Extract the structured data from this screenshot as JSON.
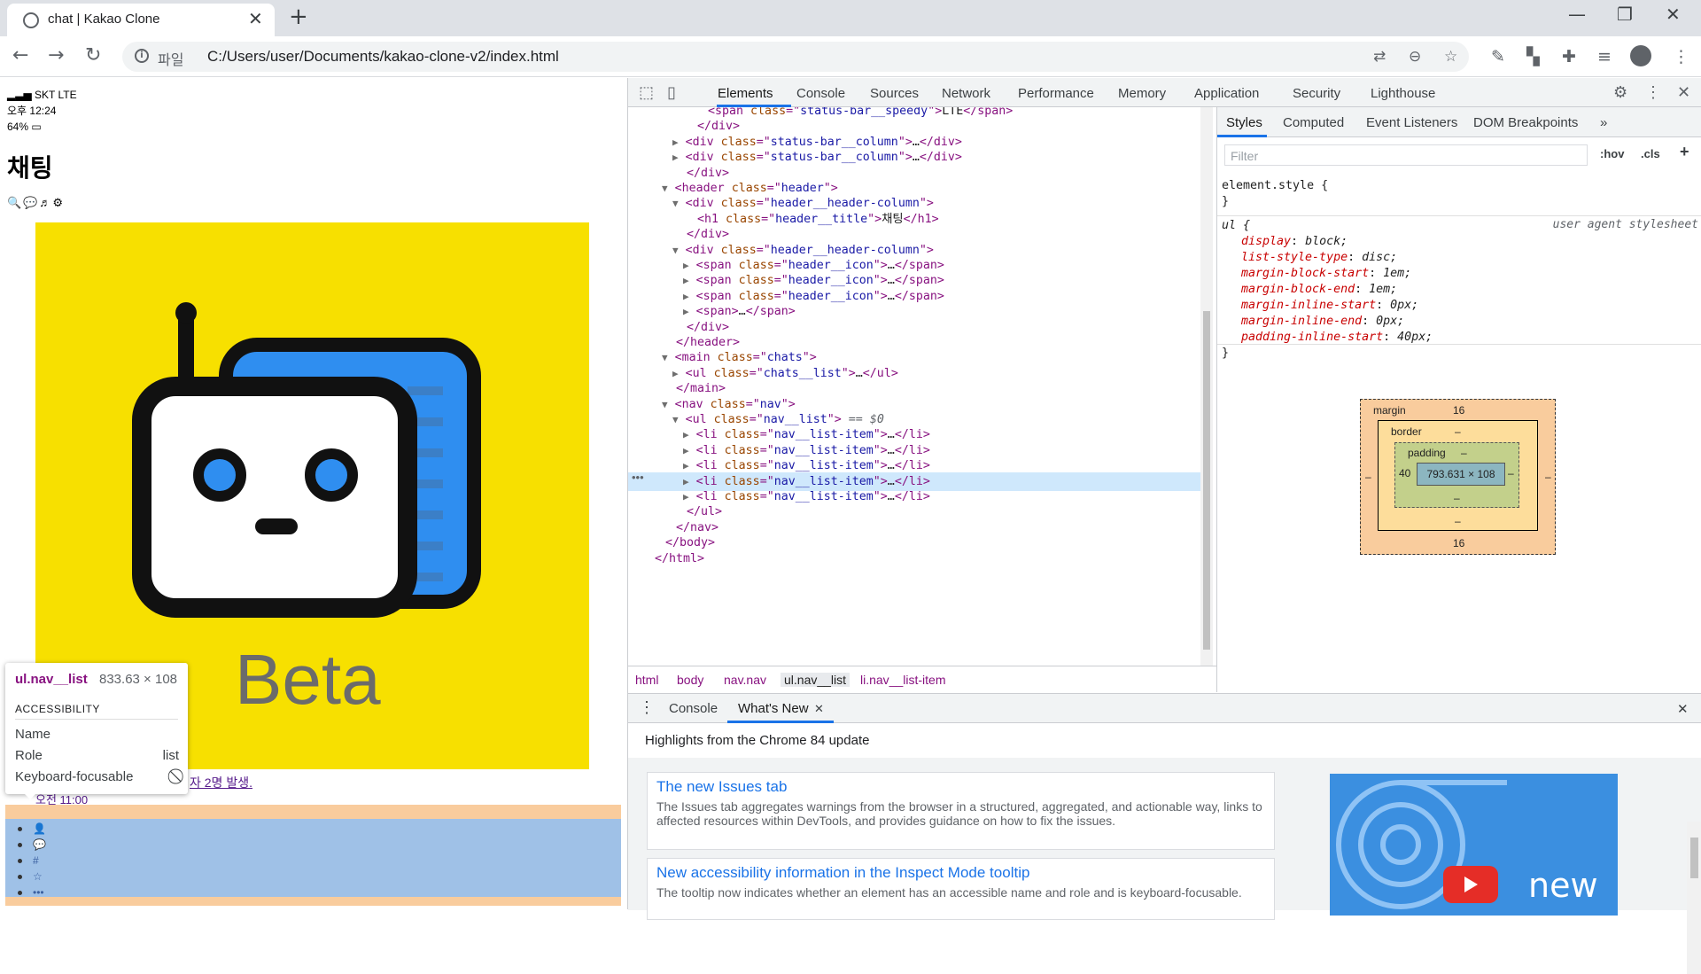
{
  "browser": {
    "tab_title": "chat | Kakao Clone",
    "address_label": "파일",
    "url": "C:/Users/user/Documents/kakao-clone-v2/index.html"
  },
  "page": {
    "status_carrier": "SKT LTE",
    "status_time": "오후 12:24",
    "status_battery": "64%",
    "heading": "채팅",
    "header_icons": "🔍💬♬⚙",
    "image_text": "Beta",
    "chat_link_1": "자 2명 발생.",
    "chat_link_2": "오전 11:00",
    "nav_items": [
      "👤",
      "💬",
      "#",
      "☆",
      "•••"
    ]
  },
  "tooltip": {
    "tag": "ul.nav__list",
    "size": "833.63 × 108",
    "section": "ACCESSIBILITY",
    "rows": [
      {
        "label": "Name",
        "value": ""
      },
      {
        "label": "Role",
        "value": "list"
      },
      {
        "label": "Keyboard-focusable",
        "value": "⃠"
      }
    ]
  },
  "devtools": {
    "tabs": [
      "Elements",
      "Console",
      "Sources",
      "Network",
      "Performance",
      "Memory",
      "Application",
      "Security",
      "Lighthouse"
    ],
    "dom_lines": [
      {
        "indent": 5,
        "tri": "",
        "html": "<span class=\"status-bar__speedy\">LTE</span>"
      },
      {
        "indent": 4,
        "tri": "",
        "html": "</div>"
      },
      {
        "indent": 3,
        "tri": "▶",
        "html": "<div class=\"status-bar__column\">…</div>"
      },
      {
        "indent": 3,
        "tri": "▶",
        "html": "<div class=\"status-bar__column\">…</div>"
      },
      {
        "indent": 3,
        "tri": "",
        "html": "</div>"
      },
      {
        "indent": 2,
        "tri": "▼",
        "html": "<header class=\"header\">"
      },
      {
        "indent": 3,
        "tri": "▼",
        "html": "<div class=\"header__header-column\">"
      },
      {
        "indent": 4,
        "tri": "",
        "html": "<h1 class=\"header__title\">채팅</h1>"
      },
      {
        "indent": 3,
        "tri": "",
        "html": "</div>"
      },
      {
        "indent": 3,
        "tri": "▼",
        "html": "<div class=\"header__header-column\">"
      },
      {
        "indent": 4,
        "tri": "▶",
        "html": "<span class=\"header__icon\">…</span>"
      },
      {
        "indent": 4,
        "tri": "▶",
        "html": "<span class=\"header__icon\">…</span>"
      },
      {
        "indent": 4,
        "tri": "▶",
        "html": "<span class=\"header__icon\">…</span>"
      },
      {
        "indent": 4,
        "tri": "▶",
        "html": "<span>…</span>"
      },
      {
        "indent": 3,
        "tri": "",
        "html": "</div>"
      },
      {
        "indent": 2,
        "tri": "",
        "html": "</header>"
      },
      {
        "indent": 2,
        "tri": "▼",
        "html": "<main class=\"chats\">"
      },
      {
        "indent": 3,
        "tri": "▶",
        "html": "<ul class=\"chats__list\">…</ul>"
      },
      {
        "indent": 2,
        "tri": "",
        "html": "</main>"
      },
      {
        "indent": 2,
        "tri": "▼",
        "html": "<nav class=\"nav\">"
      },
      {
        "indent": 3,
        "tri": "▼",
        "html": "<ul class=\"nav__list\"> == $0"
      },
      {
        "indent": 4,
        "tri": "▶",
        "html": "<li class=\"nav__list-item\">…</li>"
      },
      {
        "indent": 4,
        "tri": "▶",
        "html": "<li class=\"nav__list-item\">…</li>"
      },
      {
        "indent": 4,
        "tri": "▶",
        "html": "<li class=\"nav__list-item\">…</li>"
      },
      {
        "indent": 4,
        "tri": "▶",
        "html": "<li class=\"nav__list-item\">…</li>"
      },
      {
        "indent": 4,
        "tri": "▶",
        "html": "<li class=\"nav__list-item\">…</li>"
      },
      {
        "indent": 3,
        "tri": "",
        "html": "</ul>"
      },
      {
        "indent": 2,
        "tri": "",
        "html": "</nav>"
      },
      {
        "indent": 1,
        "tri": "",
        "html": "</body>"
      },
      {
        "indent": 0,
        "tri": "",
        "html": "</html>"
      }
    ],
    "breadcrumbs": [
      "html",
      "body",
      "nav.nav",
      "ul.nav__list",
      "li.nav__list-item"
    ],
    "styles_tabs": [
      "Styles",
      "Computed",
      "Event Listeners",
      "DOM Breakpoints"
    ],
    "filter_placeholder": "Filter",
    "hov": ":hov",
    "cls": ".cls",
    "element_style": "element.style {",
    "rule_selector": "ul {",
    "rule_origin": "user agent stylesheet",
    "rule_props": [
      {
        "prop": "display",
        "val": "block;"
      },
      {
        "prop": "list-style-type",
        "val": "disc;"
      },
      {
        "prop": "margin-block-start",
        "val": "1em;"
      },
      {
        "prop": "margin-block-end",
        "val": "1em;"
      },
      {
        "prop": "margin-inline-start",
        "val": "0px;"
      },
      {
        "prop": "margin-inline-end",
        "val": "0px;"
      },
      {
        "prop": "padding-inline-start",
        "val": "40px;"
      }
    ],
    "boxmodel": {
      "margin_label": "margin",
      "margin_top": "16",
      "margin_bottom": "16",
      "margin_side": "–",
      "border_label": "border",
      "border_value": "–",
      "padding_label": "padding",
      "padding_value": "–",
      "padding_left": "40",
      "content": "793.631 × 108"
    },
    "drawer_tabs": [
      "Console",
      "What's New"
    ],
    "highlights": "Highlights from the Chrome 84 update",
    "cards": [
      {
        "title": "The new Issues tab",
        "body": "The Issues tab aggregates warnings from the browser in a structured, aggregated, and actionable way, links to affected resources within DevTools, and provides guidance on how to fix the issues."
      },
      {
        "title": "New accessibility information in the Inspect Mode tooltip",
        "body": "The tooltip now indicates whether an element has an accessible name and role and is keyboard-focusable."
      }
    ],
    "whatsnew_badge": "new"
  }
}
